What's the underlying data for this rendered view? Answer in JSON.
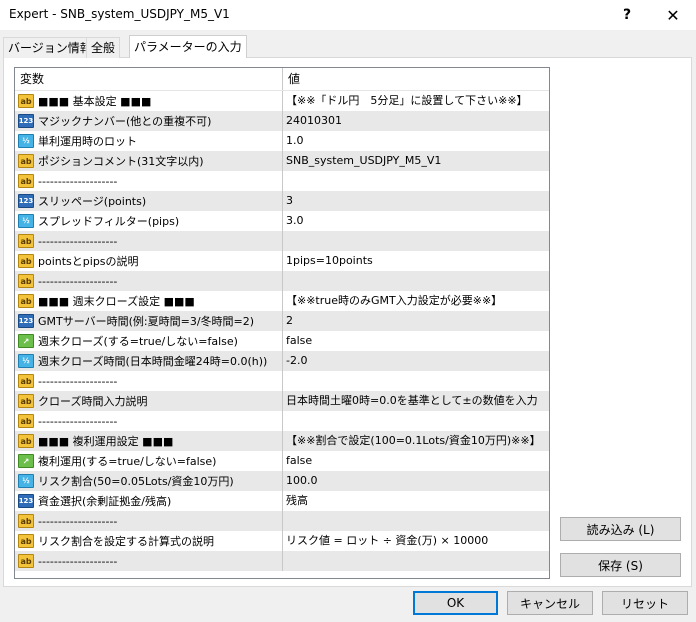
{
  "window": {
    "title": "Expert - SNB_system_USDJPY_M5_V1",
    "help_label": "?",
    "close_label": "✕"
  },
  "tabs": [
    {
      "label": "バージョン情報"
    },
    {
      "label": "全般"
    },
    {
      "label": "パラメーターの入力"
    }
  ],
  "grid": {
    "headers": {
      "name": "変数",
      "value": "値"
    },
    "rows": [
      {
        "type": "ab",
        "name": "■■■ 基本設定 ■■■",
        "value": "【※※「ドル円　5分足」に設置して下さい※※】"
      },
      {
        "type": "int",
        "name": "マジックナンバー(他との重複不可)",
        "value": "24010301"
      },
      {
        "type": "dbl",
        "name": "単利運用時のロット",
        "value": "1.0"
      },
      {
        "type": "ab",
        "name": "ポジションコメント(31文字以内)",
        "value": "SNB_system_USDJPY_M5_V1"
      },
      {
        "type": "ab",
        "name": "--------------------",
        "value": ""
      },
      {
        "type": "int",
        "name": "スリッページ(points)",
        "value": "3"
      },
      {
        "type": "dbl",
        "name": "スプレッドフィルター(pips)",
        "value": "3.0"
      },
      {
        "type": "ab",
        "name": "--------------------",
        "value": ""
      },
      {
        "type": "ab",
        "name": "pointsとpipsの説明",
        "value": "1pips=10points"
      },
      {
        "type": "ab",
        "name": "--------------------",
        "value": ""
      },
      {
        "type": "ab",
        "name": "■■■ 週末クローズ設定 ■■■",
        "value": "【※※true時のみGMT入力設定が必要※※】"
      },
      {
        "type": "int",
        "name": "GMTサーバー時間(例:夏時間=3/冬時間=2)",
        "value": "2"
      },
      {
        "type": "bool",
        "name": "週末クローズ(する=true/しない=false)",
        "value": "false"
      },
      {
        "type": "dbl",
        "name": "週末クローズ時間(日本時間金曜24時=0.0(h))",
        "value": "-2.0"
      },
      {
        "type": "ab",
        "name": "--------------------",
        "value": ""
      },
      {
        "type": "ab",
        "name": "クローズ時間入力説明",
        "value": "日本時間土曜0時=0.0を基準として±の数値を入力"
      },
      {
        "type": "ab",
        "name": "--------------------",
        "value": ""
      },
      {
        "type": "ab",
        "name": "■■■ 複利運用設定 ■■■",
        "value": "【※※割合で設定(100=0.1Lots/資金10万円)※※】"
      },
      {
        "type": "bool",
        "name": "複利運用(する=true/しない=false)",
        "value": "false"
      },
      {
        "type": "dbl",
        "name": "リスク割合(50=0.05Lots/資金10万円)",
        "value": "100.0"
      },
      {
        "type": "enum",
        "name": "資金選択(余剰証拠金/残高)",
        "value": "残高"
      },
      {
        "type": "ab",
        "name": "--------------------",
        "value": ""
      },
      {
        "type": "ab",
        "name": "リスク割合を設定する計算式の説明",
        "value": "リスク値 = ロット ÷ 資金(万) × 10000"
      },
      {
        "type": "ab",
        "name": "--------------------",
        "value": ""
      }
    ]
  },
  "icons": {
    "ab": "ab",
    "int": "123",
    "dbl": "½",
    "bool": "↗",
    "enum": "123"
  },
  "buttons": {
    "load": "読み込み (L)",
    "save": "保存 (S)",
    "ok": "OK",
    "cancel": "キャンセル",
    "reset": "リセット"
  }
}
